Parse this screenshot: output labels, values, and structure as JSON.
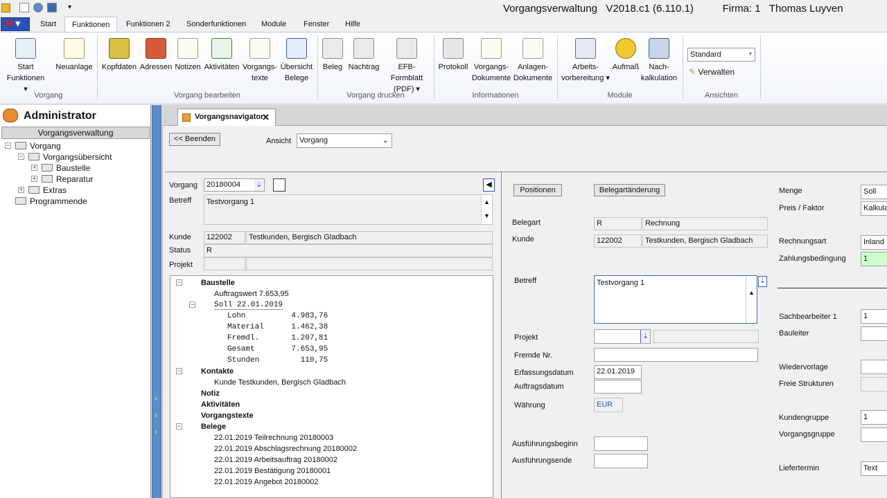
{
  "window": {
    "title": "Vorgangsverwaltung   V2018.c1 (6.110.1)          Firma: 1   Thomas Luyven"
  },
  "menu": {
    "app_button": "M",
    "tabs": [
      "Start",
      "Funktionen",
      "Funktionen 2",
      "Sonderfunktionen",
      "Module",
      "Fenster",
      "Hilfe"
    ]
  },
  "ribbon": {
    "groups": [
      "Vorgang",
      "Vorgang bearbeiten",
      "Vorgang drucken",
      "Informationen",
      "Module",
      "Ansichten"
    ],
    "start_funktionen": [
      "Start",
      "Funktionen"
    ],
    "neuanlage": "Neuanlage",
    "kopfdaten": "Kopfdaten",
    "adressen": "Adressen",
    "notizen": "Notizen",
    "aktivitaeten": "Aktivitäten",
    "vorgangstexte": [
      "Vorgangs-",
      "texte"
    ],
    "uebersicht_belege": [
      "Übersicht",
      "Belege"
    ],
    "beleg": "Beleg",
    "nachtrag": "Nachtrag",
    "efb": [
      "EFB-Formblatt",
      "(PDF)"
    ],
    "protokoll": "Protokoll",
    "vorgangs_dokumente": [
      "Vorgangs-",
      "Dokumente"
    ],
    "anlagen_dokumente": [
      "Anlagen-",
      "Dokumente"
    ],
    "arbeitsvorbereitung": [
      "Arbeits-",
      "vorbereitung"
    ],
    "aufmass": "Aufmaß",
    "nachkalkulation": [
      "Nach-",
      "kalkulation"
    ],
    "ansicht_select": "Standard",
    "verwalten": "Verwalten"
  },
  "left": {
    "header": "Administrator",
    "section": "Vorgangsverwaltung",
    "tree": {
      "vorgang": "Vorgang",
      "vorgangsuebersicht": "Vorgangsübersicht",
      "baustelle": "Baustelle",
      "reparatur": "Reparatur",
      "extras": "Extras",
      "programmende": "Programmende"
    }
  },
  "doc_tab": {
    "label": "Vorgangsnavigator",
    "close": "✕"
  },
  "toolbar": {
    "beenden": "<< Beenden",
    "ansicht_label": "Ansicht",
    "ansicht_value": "Vorgang"
  },
  "vorgang_form": {
    "vorgang_label": "Vorgang",
    "vorgang_value": "20180004",
    "betreff_label": "Betreff",
    "betreff_value": "Testvorgang 1",
    "kunde_label": "Kunde",
    "kunde_nr": "122002",
    "kunde_name": "Testkunden, Bergisch Gladbach",
    "status_label": "Status",
    "status_value": "R",
    "projekt_label": "Projekt"
  },
  "nav_tree": {
    "baustelle": "Baustelle",
    "auftragswert": "Auftragswert  7.653,95",
    "soll": "Soll          22.01.2019",
    "lohn": "Lohn          4.983,76",
    "material": "Material      1.462,38",
    "fremdl": "Fremdl.       1.207,81",
    "gesamt": "Gesamt        7.653,95",
    "stunden": "Stunden         110,75",
    "kontakte": "Kontakte",
    "kunde": "Kunde  Testkunden, Bergisch Gladbach",
    "notiz": "Notiz",
    "aktivitaeten": "Aktivitäten",
    "vorgangstexte": "Vorgangstexte",
    "belege": "Belege",
    "beleg_items": [
      "22.01.2019  Teilrechnung 20180003",
      "22.01.2019  Abschlagsrechnung 20180002",
      "22.01.2019  Arbeitsauftrag 20180002",
      "22.01.2019  Bestätigung 20180001",
      "22.01.2019  Angebot 20180002"
    ]
  },
  "beleg_form": {
    "positionen": "Positionen",
    "belegartaenderung": "Belegartänderung",
    "belegart_label": "Belegart",
    "belegart_code": "R",
    "belegart_name": "Rechnung",
    "kunde_label": "Kunde",
    "kunde_nr": "122002",
    "kunde_name": "Testkunden, Bergisch Gladbach",
    "betreff_label": "Betreff",
    "betreff_value": "Testvorgang 1",
    "projekt_label": "Projekt",
    "fremde_nr_label": "Fremde Nr.",
    "erfassungsdatum_label": "Erfassungsdatum",
    "erfassungsdatum_value": "22.01.2019",
    "auftragsdatum_label": "Auftragsdatum",
    "waehrung_label": "Währung",
    "waehrung_value": "EUR",
    "ausfuehrungsbeginn_label": "Ausführungsbeginn",
    "ausfuehrungsende_label": "Ausführungsende"
  },
  "right_form": {
    "menge_label": "Menge",
    "menge_value": "Soll",
    "preis_label": "Preis / Faktor",
    "preis_value": "Kalkula",
    "rechnungsart_label": "Rechnungsart",
    "rechnungsart_value": "Inland",
    "zahlungsbedingung_label": "Zahlungsbedingung",
    "zahlungsbedingung_value": "1",
    "sachbearbeiter_label": "Sachbearbeiter 1",
    "sachbearbeiter_value": "1",
    "bauleiter_label": "Bauleiter",
    "wiedervorlage_label": "Wiedervorlage",
    "freie_strukturen_label": "Freie Strukturen",
    "kundengruppe_label": "Kundengruppe",
    "kundengruppe_value": "1",
    "vorgangsgruppe_label": "Vorgangsgruppe",
    "liefertermin_label": "Liefertermin",
    "liefertermin_value": "Text"
  },
  "colors": {
    "accent": "#2a53b8",
    "splitter": "#5b8ec8",
    "highlight_field": "#ccffcc"
  }
}
